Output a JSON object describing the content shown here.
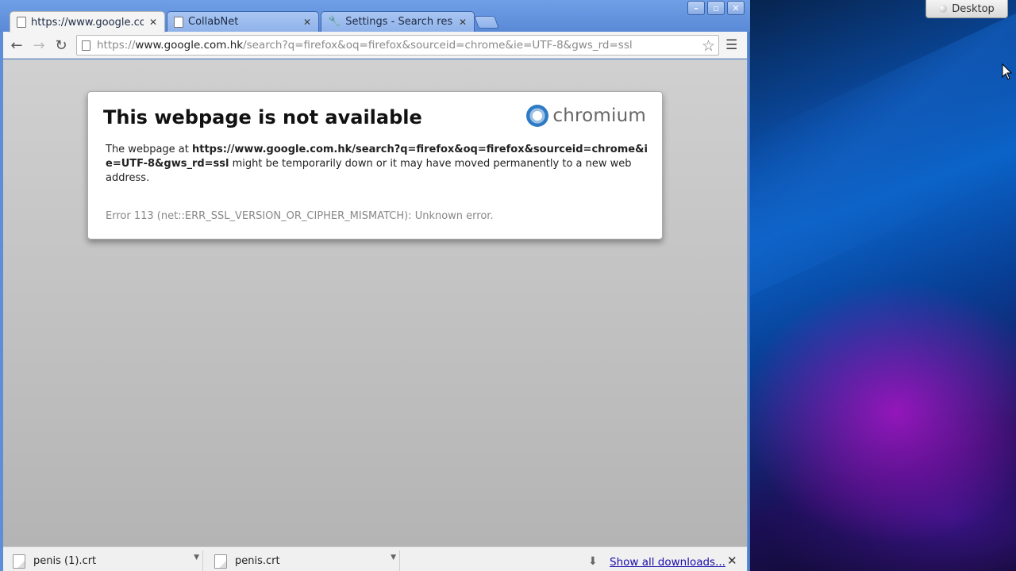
{
  "browser": {
    "tabs": [
      {
        "label": "https://www.google.com.hk/search?q=firefox",
        "active": true
      },
      {
        "label": "CollabNet",
        "active": false
      },
      {
        "label": "Settings - Search results",
        "active": false
      }
    ],
    "address": {
      "scheme": "https://",
      "host": "www.google.com.hk",
      "path": "/search?q=firefox&oq=firefox&sourceid=chrome&ie=UTF-8&gws_rd=ssl"
    }
  },
  "error_page": {
    "title": "This webpage is not available",
    "logo_text": "chromium",
    "desc_prefix": "The webpage at ",
    "desc_url": "https://www.google.com.hk/search?q=firefox&oq=firefox&sourceid=chrome&ie=UTF-8&gws_rd=ssl",
    "desc_suffix": " might be temporarily down or it may have moved permanently to a new web address.",
    "error_code": "Error 113 (net::ERR_SSL_VERSION_OR_CIPHER_MISMATCH): Unknown error."
  },
  "downloads": {
    "items": [
      {
        "filename": "penis (1).crt"
      },
      {
        "filename": "penis.crt"
      }
    ],
    "show_all_label": "Show all downloads..."
  },
  "desktop": {
    "button_label": "Desktop"
  },
  "colors": {
    "titlebar": "#5f8ed8",
    "link": "#1a0dab"
  }
}
